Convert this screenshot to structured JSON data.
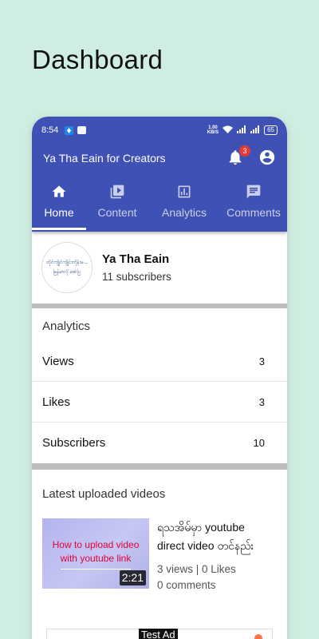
{
  "page_heading": "Dashboard",
  "status_bar": {
    "time": "8:54",
    "speed": "1.00",
    "speed_unit": "KB/S",
    "battery": "65"
  },
  "app_bar": {
    "title": "Ya Tha Eain for Creators",
    "notification_count": "3"
  },
  "tabs": [
    {
      "label": "Home",
      "icon": "home-icon",
      "active": true
    },
    {
      "label": "Content",
      "icon": "video-library-icon",
      "active": false
    },
    {
      "label": "Analytics",
      "icon": "analytics-icon",
      "active": false
    },
    {
      "label": "Comments",
      "icon": "comment-icon",
      "active": false
    }
  ],
  "channel": {
    "name": "Ya Tha Eain",
    "subscribers": "11 subscribers",
    "avatar_text_line1": "ထိုင်ကျိုင်ကျိုင်းကိုန်းမ...",
    "avatar_text_line2": "မြန်မာလို ဖော်ပြ"
  },
  "analytics": {
    "title": "Analytics",
    "rows": [
      {
        "label": "Views",
        "value": "3"
      },
      {
        "label": "Likes",
        "value": "3"
      },
      {
        "label": "Subscribers",
        "value": "10"
      }
    ]
  },
  "latest": {
    "title": "Latest uploaded videos",
    "videos": [
      {
        "thumb_line1": "How to upload video",
        "thumb_line2": "with youtube link",
        "duration": "2:21",
        "title": "ရသအိမ်မှာ youtube direct video တင်နည်း",
        "views": "3 views | 0 Likes",
        "comments": "0 comments"
      }
    ]
  },
  "ad": {
    "label": "Test Ad"
  },
  "colors": {
    "primary": "#3f51b5",
    "background": "#cfeee1",
    "badge": "#e53935"
  }
}
